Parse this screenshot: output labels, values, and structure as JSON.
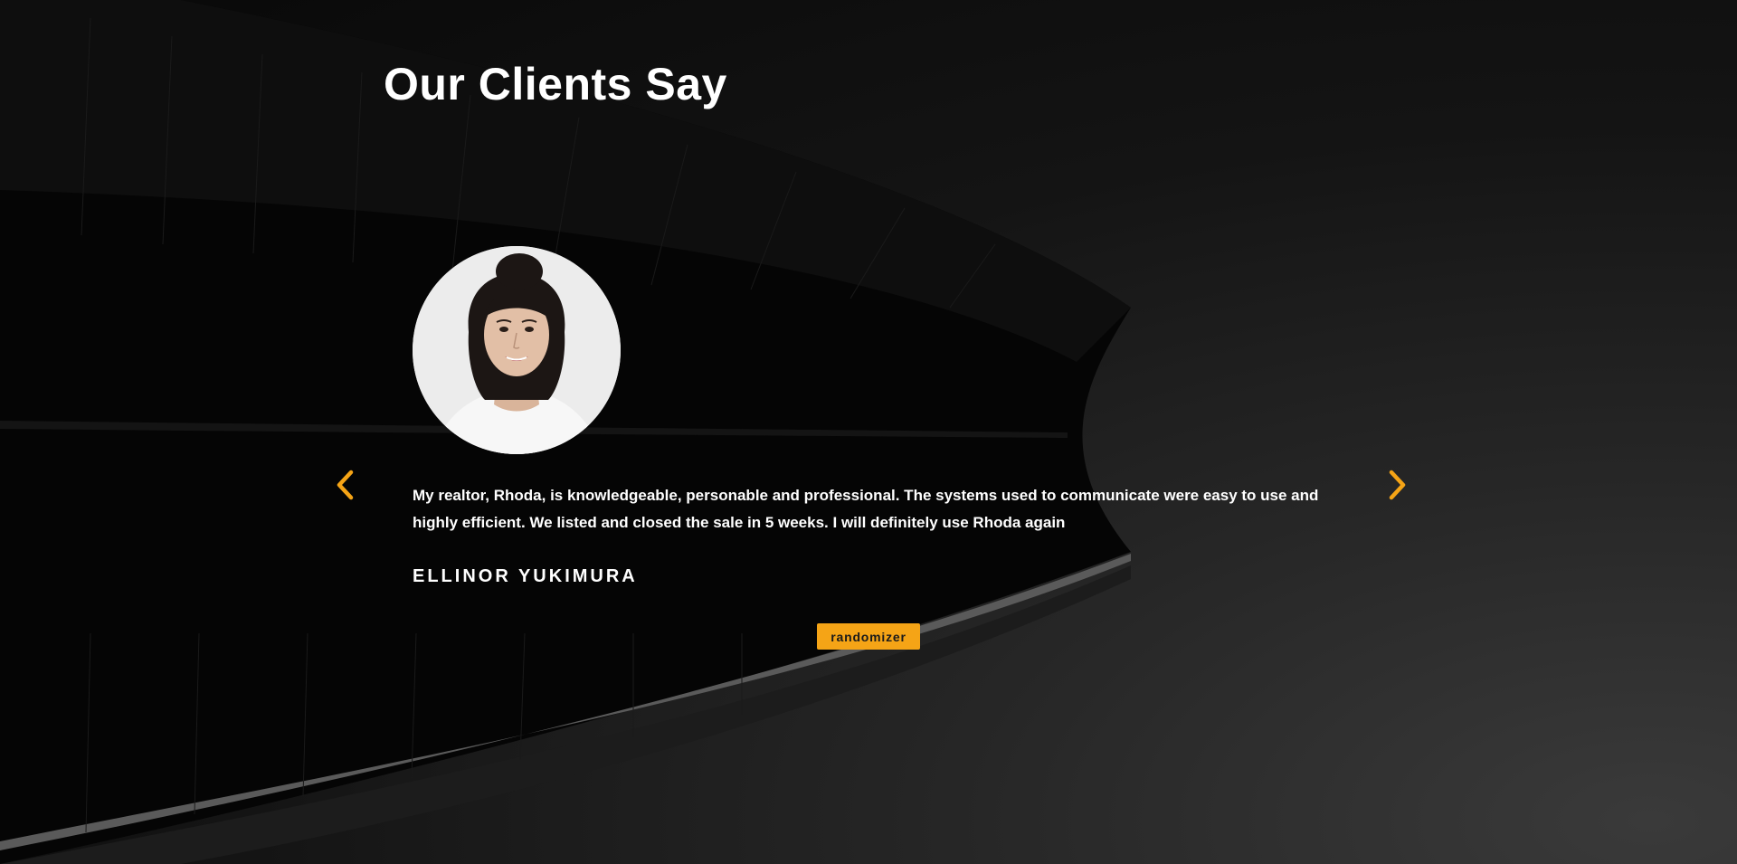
{
  "section": {
    "title": "Our Clients Say"
  },
  "testimonial": {
    "quote": "My realtor, Rhoda, is knowledgeable, personable and professional. The systems used to communicate were easy to use and highly efficient. We listed and closed the sale in 5 weeks. I will definitely use Rhoda again",
    "author": "ELLINOR YUKIMURA"
  },
  "controls": {
    "prev_icon": "chevron-left-icon",
    "next_icon": "chevron-right-icon",
    "randomizer_label": "randomizer"
  },
  "colors": {
    "accent": "#f5a416",
    "text": "#ffffff",
    "background": "#0a0a0a"
  }
}
